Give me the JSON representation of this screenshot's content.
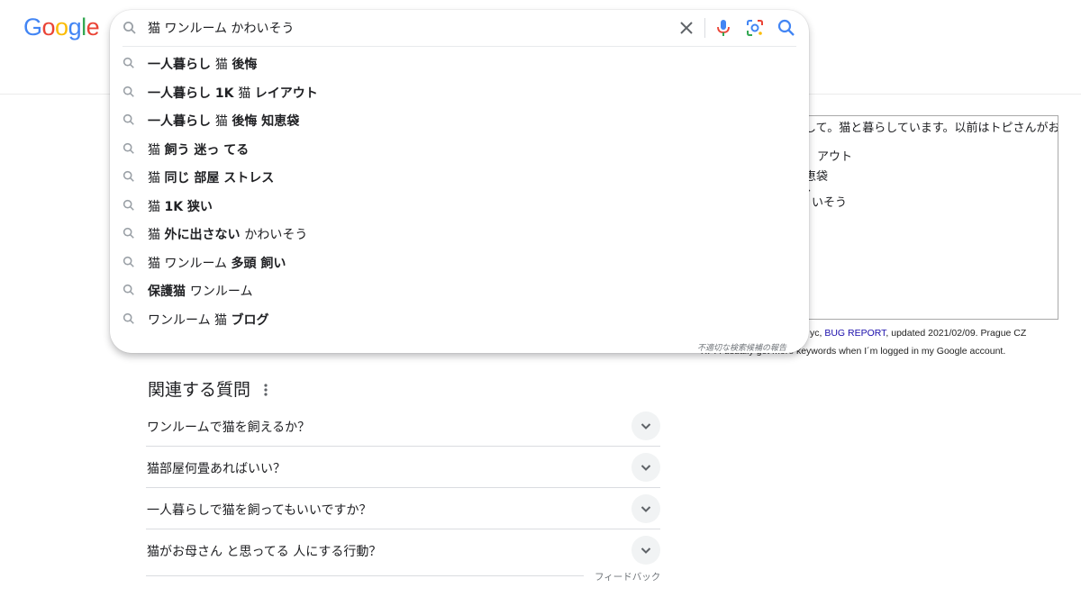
{
  "logo": {
    "letters": [
      "G",
      "o",
      "o",
      "g",
      "l",
      "e"
    ]
  },
  "search": {
    "query": "猫 ワンルーム かわいそう"
  },
  "suggestions": [
    {
      "parts": [
        {
          "t": "一人暮らし ",
          "b": true
        },
        {
          "t": "猫 ",
          "b": false
        },
        {
          "t": "後悔",
          "b": true
        }
      ]
    },
    {
      "parts": [
        {
          "t": "一人暮らし 1K ",
          "b": true
        },
        {
          "t": "猫 ",
          "b": false
        },
        {
          "t": "レイアウト",
          "b": true
        }
      ]
    },
    {
      "parts": [
        {
          "t": "一人暮らし ",
          "b": true
        },
        {
          "t": "猫 ",
          "b": false
        },
        {
          "t": "後悔 知恵袋",
          "b": true
        }
      ]
    },
    {
      "parts": [
        {
          "t": "猫 ",
          "b": false
        },
        {
          "t": "飼う 迷っ てる",
          "b": true
        }
      ]
    },
    {
      "parts": [
        {
          "t": "猫 ",
          "b": false
        },
        {
          "t": "同じ 部屋 ストレス",
          "b": true
        }
      ]
    },
    {
      "parts": [
        {
          "t": "猫 ",
          "b": false
        },
        {
          "t": "1K 狭い",
          "b": true
        }
      ]
    },
    {
      "parts": [
        {
          "t": "猫 ",
          "b": false
        },
        {
          "t": "外に出さない ",
          "b": true
        },
        {
          "t": "かわいそう",
          "b": false
        }
      ]
    },
    {
      "parts": [
        {
          "t": "猫 ワンルーム ",
          "b": false
        },
        {
          "t": "多頭 飼い",
          "b": true
        }
      ]
    },
    {
      "parts": [
        {
          "t": "保護猫 ",
          "b": true
        },
        {
          "t": "ワンルーム",
          "b": false
        }
      ]
    },
    {
      "parts": [
        {
          "t": "ワンルーム 猫 ",
          "b": false
        },
        {
          "t": "ブログ",
          "b": true
        }
      ]
    }
  ],
  "report_link": "不適切な検索候補の報告",
  "background_text": {
    "textarea_lines": [
      "めまして。猫と暮らしています。以前はトピさんがお",
      "アウト",
      "恵袋",
      "、",
      "いそう"
    ],
    "footer_link_prefix": "yc, ",
    "footer_link": "BUG REPORT",
    "footer_suffix": ", updated 2021/02/09. Prague CZ",
    "footer_line2": "TIP: I usually get more keywords when I´m logged in my Google account."
  },
  "related": {
    "title": "関連する質問",
    "questions": [
      "ワンルームで猫を飼えるか？",
      "猫部屋何畳あればいい？",
      "一人暮らしで猫を飼ってもいいですか？",
      "猫がお母さん と思ってる 人にする行動？"
    ],
    "feedback": "フィードバック"
  }
}
